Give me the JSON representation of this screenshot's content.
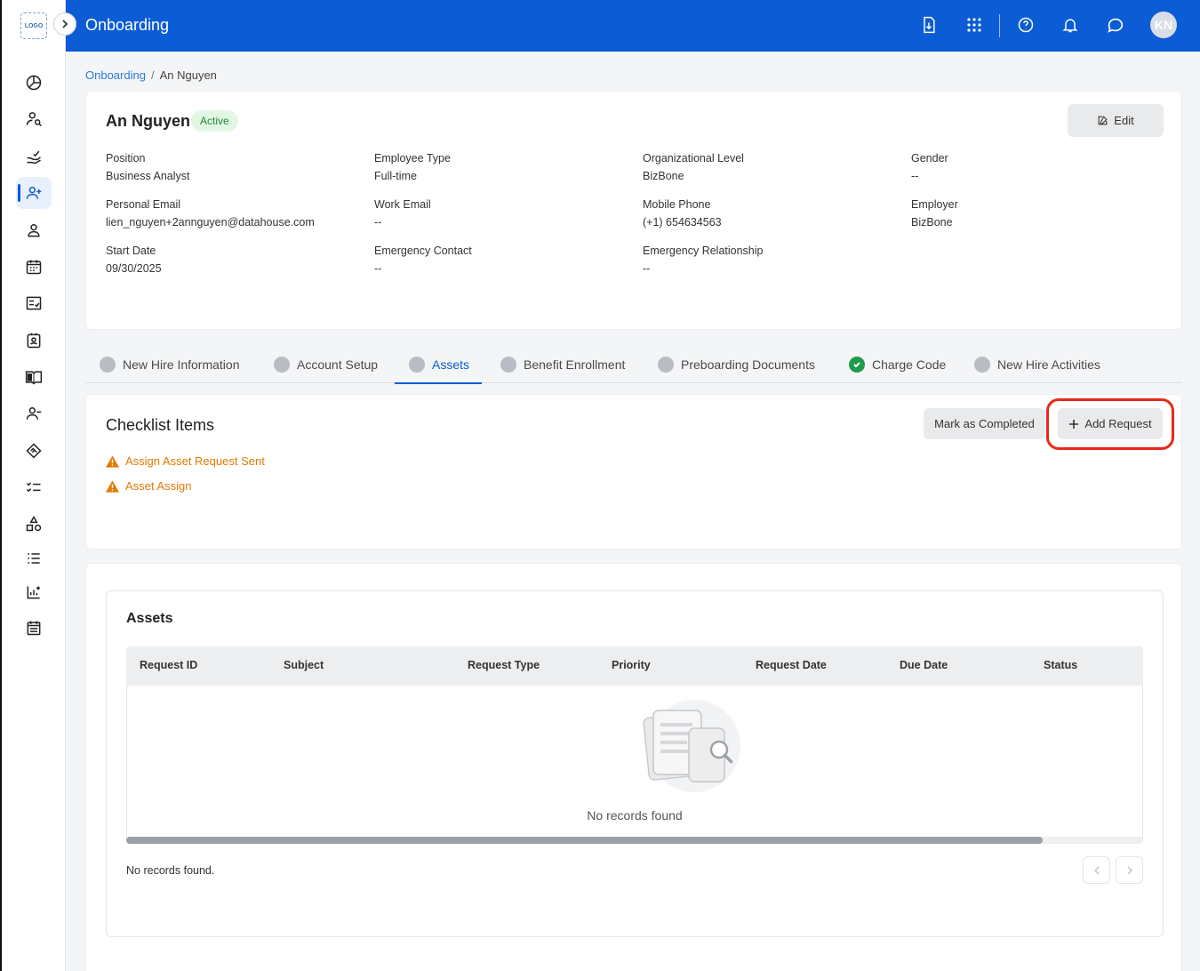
{
  "app": {
    "title": "Onboarding",
    "logo_text": "LOGO"
  },
  "header": {
    "avatar_initials": "KN",
    "icons": [
      "download-icon",
      "apps-grid-icon",
      "help-icon",
      "notification-bell-icon",
      "chat-icon"
    ]
  },
  "breadcrumb": {
    "parent": "Onboarding",
    "separator": "/",
    "current": "An Nguyen"
  },
  "profile": {
    "name": "An Nguyen",
    "status": "Active",
    "edit_label": "Edit",
    "fields": [
      {
        "label": "Position",
        "value": "Business Analyst"
      },
      {
        "label": "Employee Type",
        "value": "Full-time"
      },
      {
        "label": "Organizational Level",
        "value": "BizBone"
      },
      {
        "label": "Gender",
        "value": "--"
      },
      {
        "label": "Personal Email",
        "value": "lien_nguyen+2annguyen@datahouse.com"
      },
      {
        "label": "Work Email",
        "value": "--"
      },
      {
        "label": "Mobile Phone",
        "value": "(+1) 654634563"
      },
      {
        "label": "Employer",
        "value": "BizBone"
      },
      {
        "label": "Start Date",
        "value": "09/30/2025"
      },
      {
        "label": "Emergency Contact",
        "value": "--"
      },
      {
        "label": "Emergency Relationship",
        "value": "--"
      }
    ]
  },
  "tabs": [
    {
      "label": "New Hire Information",
      "state": "pending"
    },
    {
      "label": "Account Setup",
      "state": "pending"
    },
    {
      "label": "Assets",
      "state": "active"
    },
    {
      "label": "Benefit Enrollment",
      "state": "pending"
    },
    {
      "label": "Preboarding Documents",
      "state": "pending"
    },
    {
      "label": "Charge Code",
      "state": "done"
    },
    {
      "label": "New Hire Activities",
      "state": "pending"
    }
  ],
  "checklist": {
    "title": "Checklist Items",
    "mark_completed_label": "Mark as Completed",
    "add_request_label": "Add Request",
    "items": [
      "Assign Asset Request Sent",
      "Asset Assign"
    ],
    "warning_color": "#e07a00"
  },
  "assets": {
    "title": "Assets",
    "columns": [
      "Request ID",
      "Subject",
      "Request Type",
      "Priority",
      "Request Date",
      "Due Date",
      "Status"
    ],
    "rows": [],
    "empty_text": "No records found",
    "footer_text": "No records found."
  },
  "colors": {
    "brand": "#0b5cd5",
    "success": "#1f9d4c",
    "highlight": "#e8291a"
  }
}
